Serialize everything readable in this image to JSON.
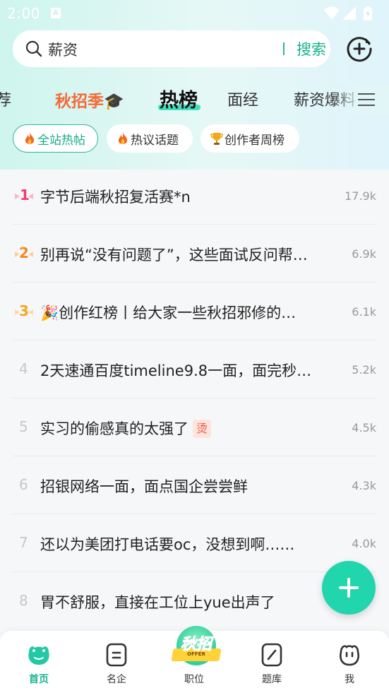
{
  "status_bar": {
    "time": "2:00",
    "notification_letter": "A"
  },
  "search": {
    "query": "薪资",
    "button_label": "搜索"
  },
  "tabs": [
    {
      "label": "荐"
    },
    {
      "label": "秋招季🎓"
    },
    {
      "label": "热榜"
    },
    {
      "label": "面经"
    },
    {
      "label": "薪资爆料"
    }
  ],
  "chips": [
    {
      "label": "全站热帖"
    },
    {
      "label": "热议话题"
    },
    {
      "label": "创作者周榜"
    }
  ],
  "hot_list": [
    {
      "rank": "1",
      "title": "字节后端秋招复活赛*n",
      "count": "17.9k"
    },
    {
      "rank": "2",
      "title": "别再说“没有问题了”，这些面试反问帮…",
      "count": "6.9k"
    },
    {
      "rank": "3",
      "title": "🎉创作红榜丨给大家一些秋招邪修的…",
      "count": "6.1k"
    },
    {
      "rank": "4",
      "title": "2天速通百度timeline9.8一面，面完秒…",
      "count": "5.2k"
    },
    {
      "rank": "5",
      "title": "实习的偷感真的太强了",
      "badge": "烫",
      "count": "4.5k"
    },
    {
      "rank": "6",
      "title": "招银网络一面，面点国企尝尝鲜",
      "count": "4.3k"
    },
    {
      "rank": "7",
      "title": "还以为美团打电话要oc，没想到啊……",
      "count": "4.0k"
    },
    {
      "rank": "8",
      "title": "胃不舒服，直接在工位上yue出声了",
      "count": ""
    }
  ],
  "bottom_nav": [
    {
      "label": "首页"
    },
    {
      "label": "名企"
    },
    {
      "label": "职位"
    },
    {
      "label": "题库"
    },
    {
      "label": "我"
    }
  ],
  "promo": {
    "text": "秋招",
    "sub": "OFFER"
  },
  "colors": {
    "accent": "#1bb48f",
    "rank1": "#f03c6e",
    "rank2": "#f28a1c",
    "rank3": "#f5a623",
    "rank_other": "#c5c8cc"
  }
}
